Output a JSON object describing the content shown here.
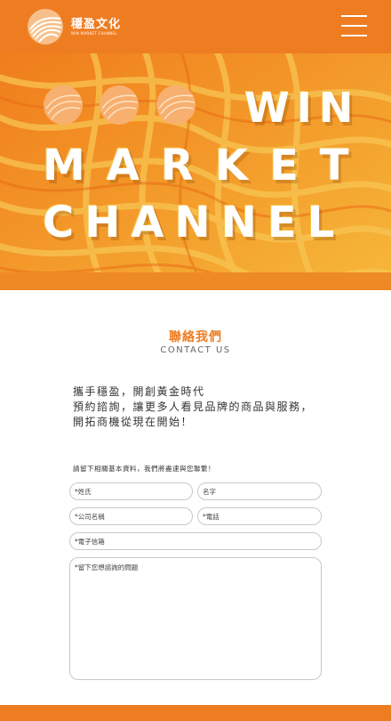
{
  "header": {
    "brand_cn": "穩盈文化",
    "brand_en": "WIN MARKET CHANNEL",
    "logo_icon": "swirl-logo-icon",
    "menu_icon": "hamburger-menu-icon",
    "bg_color": "#ee7d22"
  },
  "hero": {
    "line1": "WIN",
    "line2": "MARKET",
    "line3": "CHANNEL",
    "gradient": [
      "#f08a20",
      "#f5b93a"
    ]
  },
  "contact": {
    "title": "聯絡我們",
    "subtitle": "CONTACT US",
    "intro": [
      "攜手穩盈，開創黃金時代",
      "預約諮詢，讓更多人看見品牌的商品與服務，",
      "開拓商機從現在開始！"
    ],
    "note": "請留下相關基本資料，我們將盡速與您聯繫！",
    "fields": {
      "surname": "*姓氏",
      "given_name": "名字",
      "company": "*公司名稱",
      "phone": "*電話",
      "email": "*電子信箱",
      "message": "*留下您想諮詢的問題"
    }
  },
  "accent_color": "#ee7d22"
}
